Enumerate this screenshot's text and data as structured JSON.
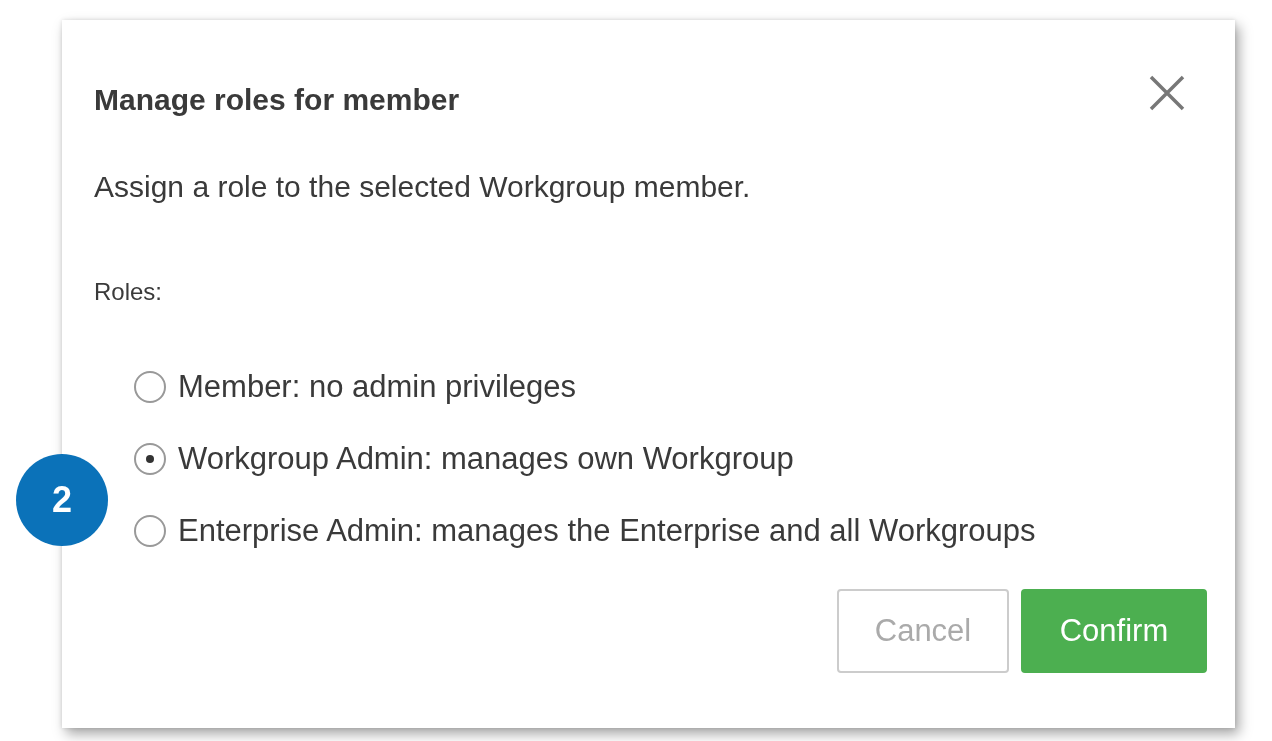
{
  "dialog": {
    "title": "Manage roles for member",
    "description": "Assign a role to the selected Workgroup member.",
    "roles_label": "Roles:",
    "roles": [
      {
        "label": "Member: no admin privileges",
        "selected": false
      },
      {
        "label": "Workgroup Admin: manages own Workgroup",
        "selected": true
      },
      {
        "label": "Enterprise Admin: manages the Enterprise and all Workgroups",
        "selected": false
      }
    ],
    "buttons": [
      {
        "label": "Cancel",
        "kind": "secondary",
        "disabled": true
      },
      {
        "label": "Confirm",
        "kind": "primary",
        "disabled": false
      }
    ]
  },
  "step_badge": {
    "label": "2"
  }
}
